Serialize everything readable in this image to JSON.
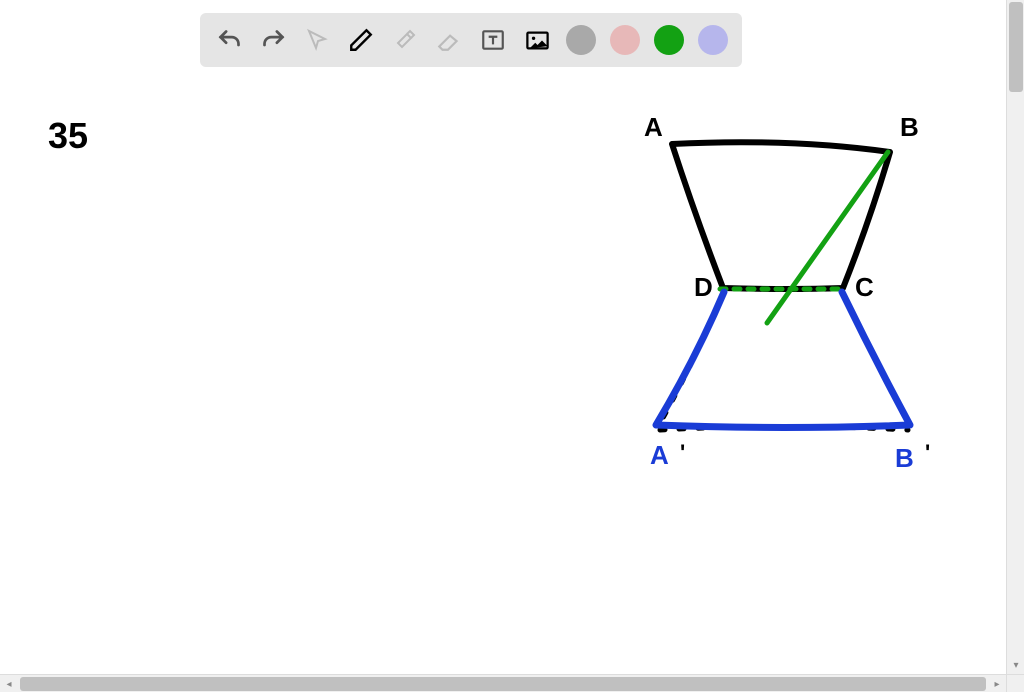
{
  "toolbar": {
    "undo": "Undo",
    "redo": "Redo",
    "select": "Select",
    "pen": "Pen",
    "hammer": "Tools",
    "eraser": "Eraser",
    "text": "Text",
    "image": "Image",
    "colors": {
      "gray": "#a9a9a9",
      "pink": "#e7b8b8",
      "green": "#13a113",
      "lavender": "#b6b6ec"
    }
  },
  "canvas": {
    "problem_number": "35",
    "labels": {
      "A": "A",
      "B": "B",
      "D": "D",
      "C": "C",
      "Aprime": "A",
      "Aprime_tick": "'",
      "Bprime": "B",
      "Bprime_tick": "'"
    }
  }
}
